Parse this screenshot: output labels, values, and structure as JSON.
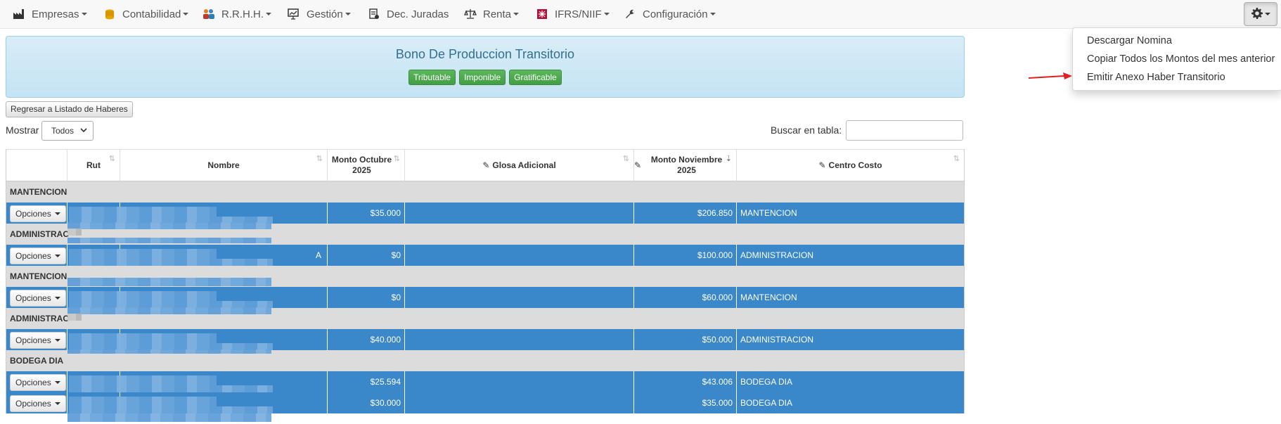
{
  "nav": {
    "items": [
      {
        "label": "Empresas",
        "icon": "factory-icon"
      },
      {
        "label": "Contabilidad",
        "icon": "coins-icon"
      },
      {
        "label": "R.R.H.H.",
        "icon": "people-icon"
      },
      {
        "label": "Gestión",
        "icon": "chart-board-icon"
      },
      {
        "label": "Dec. Juradas",
        "icon": "document-stamp-icon"
      },
      {
        "label": "Renta",
        "icon": "scale-icon"
      },
      {
        "label": "IFRS/NIIF",
        "icon": "ifrs-logo-icon"
      },
      {
        "label": "Configuración",
        "icon": "wrench-icon"
      }
    ],
    "settings_icon": "gear-icon"
  },
  "dropdown": {
    "items": [
      "Descargar Nomina",
      "Copiar Todos los Montos del mes anterior",
      "Emitir Anexo Haber Transitorio"
    ]
  },
  "panel": {
    "title": "Bono De Produccion Transitorio",
    "labels": [
      "Tributable",
      "Imponible",
      "Gratificable"
    ]
  },
  "controls": {
    "back_button": "Regresar a Listado de Haberes",
    "show_label": "Mostrar",
    "show_value": "Todos",
    "search_label": "Buscar en tabla:"
  },
  "table": {
    "headers": [
      "",
      "Rut",
      "Nombre",
      "Monto Octubre 2025",
      "Glosa Adicional",
      "Monto Noviembre 2025",
      "Centro Costo"
    ],
    "option_label": "Opciones",
    "rows": [
      {
        "type": "group",
        "label": "MANTENCION"
      },
      {
        "type": "data",
        "octubre": "$35.000",
        "noviembre": "$206.850",
        "centro": "MANTENCION",
        "name_tail": ""
      },
      {
        "type": "group",
        "label": "ADMINISTRAC"
      },
      {
        "type": "data",
        "octubre": "$0",
        "noviembre": "$100.000",
        "centro": "ADMINISTRACION",
        "name_tail": "A"
      },
      {
        "type": "group",
        "label": "MANTENCION"
      },
      {
        "type": "data",
        "octubre": "$0",
        "noviembre": "$60.000",
        "centro": "MANTENCION",
        "name_tail": ""
      },
      {
        "type": "group",
        "label": "ADMINISTRAC"
      },
      {
        "type": "data",
        "octubre": "$40.000",
        "noviembre": "$50.000",
        "centro": "ADMINISTRACION",
        "name_tail": ""
      },
      {
        "type": "group",
        "label": "BODEGA DIA"
      },
      {
        "type": "data",
        "octubre": "$25.594",
        "noviembre": "$43.006",
        "centro": "BODEGA DIA",
        "name_tail": ""
      },
      {
        "type": "data",
        "octubre": "$30.000",
        "noviembre": "$35.000",
        "centro": "BODEGA DIA",
        "name_tail": ""
      }
    ]
  },
  "colors": {
    "row_blue": "#3a87c9",
    "group_grey": "#dcdcdc",
    "label_green": "#5cb85c",
    "panel_blue": "#d9edf7",
    "arrow_red": "#e02020"
  }
}
